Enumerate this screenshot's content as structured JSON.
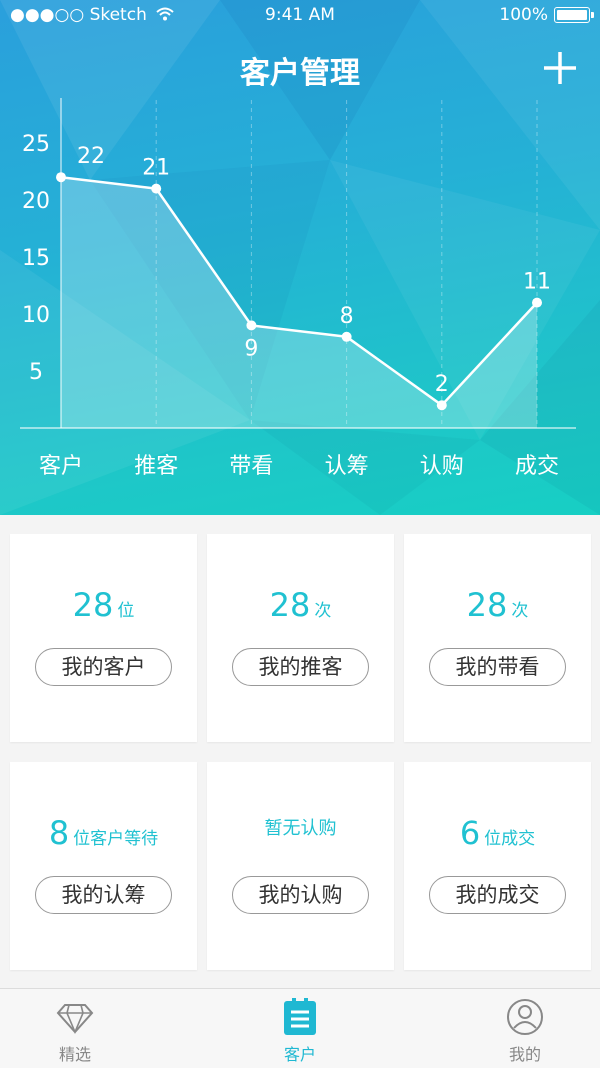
{
  "status_bar": {
    "carrier": "●●●○○ Sketch",
    "time": "9:41 AM",
    "battery": "100%"
  },
  "header": {
    "title": "客户管理",
    "add_icon": "plus-icon"
  },
  "chart_data": {
    "type": "line",
    "categories": [
      "客户",
      "推客",
      "带看",
      "认筹",
      "认购",
      "成交"
    ],
    "values": [
      22,
      21,
      9,
      8,
      2,
      11
    ],
    "data_labels": [
      "22",
      "21",
      "9",
      "8",
      "2",
      "11"
    ],
    "y_ticks": [
      "5",
      "10",
      "15",
      "20",
      "25"
    ],
    "ylim": [
      0,
      27
    ],
    "grid": "vertical dashed",
    "colors": {
      "line": "#ffffff",
      "fill": "rgba(255,255,255,0.25)"
    }
  },
  "cards": [
    {
      "number": "28",
      "unit": "位",
      "button": "我的客户"
    },
    {
      "number": "28",
      "unit": "次",
      "button": "我的推客"
    },
    {
      "number": "28",
      "unit": "次",
      "button": "我的带看"
    },
    {
      "number": "8",
      "unit": "位客户等待",
      "button": "我的认筹"
    },
    {
      "text": "暂无认购",
      "button": "我的认购"
    },
    {
      "number": "6",
      "unit": "位成交",
      "button": "我的成交"
    }
  ],
  "tabs": [
    {
      "label": "精选",
      "icon": "diamond-icon",
      "active": false
    },
    {
      "label": "客户",
      "icon": "list-icon",
      "active": true
    },
    {
      "label": "我的",
      "icon": "user-icon",
      "active": false
    }
  ],
  "colors": {
    "accent": "#20c1d1",
    "header_top": "#2a9fdc",
    "header_bottom": "#17cfc4"
  }
}
